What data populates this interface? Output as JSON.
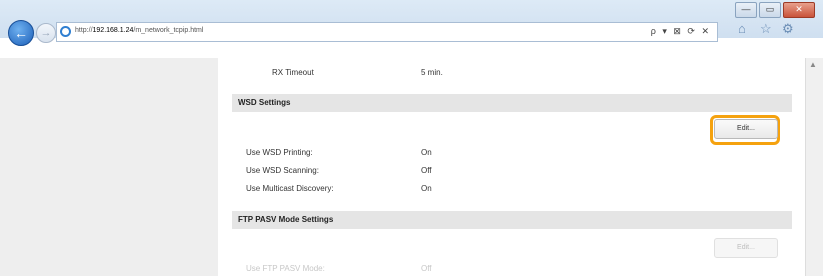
{
  "browser": {
    "url_prefix": "http://",
    "url_host": "192.168.1.24",
    "url_path": "/m_network_tcpip.html",
    "toolbar_icons": "ρ ▾ ⊠ ⟳ ✕",
    "controls": {
      "minimize": "—",
      "maximize": "▭",
      "close": "✕"
    }
  },
  "rx_timeout": {
    "label": "RX Timeout",
    "value": "5 min."
  },
  "wsd": {
    "title": "WSD Settings",
    "edit_label": "Edit...",
    "rows": [
      {
        "label": "Use WSD Printing:",
        "value": "On"
      },
      {
        "label": "Use WSD Scanning:",
        "value": "Off"
      },
      {
        "label": "Use Multicast Discovery:",
        "value": "On"
      }
    ]
  },
  "ftp": {
    "title": "FTP PASV Mode Settings",
    "edit_label": "Edit...",
    "row": {
      "label": "Use FTP PASV Mode:",
      "value": "Off"
    }
  },
  "colors": {
    "highlight": "#f5a20f",
    "section_bg": "#e5e5e5"
  }
}
